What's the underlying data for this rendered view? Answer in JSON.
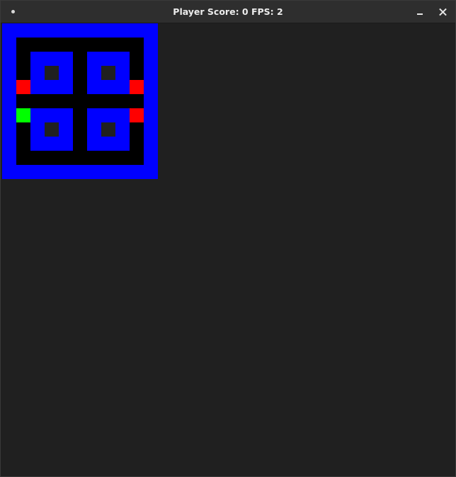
{
  "window": {
    "title": "Player Score: 0 FPS: 2"
  },
  "colors": {
    "wall": "#0000ff",
    "floor": "#000000",
    "background": "#202020",
    "enemy": "#ff0000",
    "player": "#00ff00"
  },
  "game": {
    "player_score": 0,
    "fps": 2,
    "grid": [
      "WWWWWWWWWWW",
      "W.........W",
      "W.WWW.WWW.W",
      "W.WeW.WeW.W",
      "WRWWW.WWWRW",
      "W.........W",
      "WPWWW.WWWRW",
      "W.WeW.WeW.W",
      "W.WWW.WWW.W",
      "W.........W",
      "WWWWWWWWWWW"
    ],
    "legend": {
      "W": "wall",
      ".": "floor",
      "e": "empty",
      "R": "enemy",
      "P": "player"
    }
  }
}
